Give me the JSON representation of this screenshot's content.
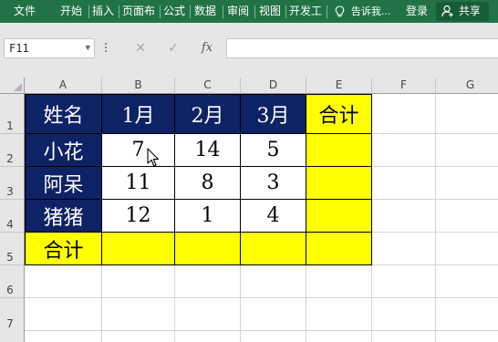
{
  "ribbon": {
    "tabs": [
      "文件",
      "开始",
      "插入",
      "页面布",
      "公式",
      "数据",
      "审阅",
      "视图",
      "开发工"
    ],
    "tell_me": "告诉我...",
    "login": "登录",
    "share": "共享",
    "color": "#217346"
  },
  "formula_bar": {
    "name_box": "F11",
    "cancel_symbol": "✕",
    "enter_symbol": "✓",
    "fx_symbol": "fx",
    "formula": ""
  },
  "columns": [
    "A",
    "B",
    "C",
    "D",
    "E",
    "F",
    "G"
  ],
  "rows": [
    "1",
    "2",
    "3",
    "4",
    "5",
    "6",
    "7"
  ],
  "table": {
    "header": [
      "姓名",
      "1月",
      "2月",
      "3月",
      "合计"
    ],
    "body": [
      [
        "小花",
        "7",
        "14",
        "5",
        ""
      ],
      [
        "阿呆",
        "11",
        "8",
        "3",
        ""
      ],
      [
        "猪猪",
        "12",
        "1",
        "4",
        ""
      ]
    ],
    "total_row": [
      "合计",
      "",
      "",
      "",
      ""
    ]
  },
  "colors": {
    "navy": "#0e2266",
    "yellow": "#ffff00"
  }
}
